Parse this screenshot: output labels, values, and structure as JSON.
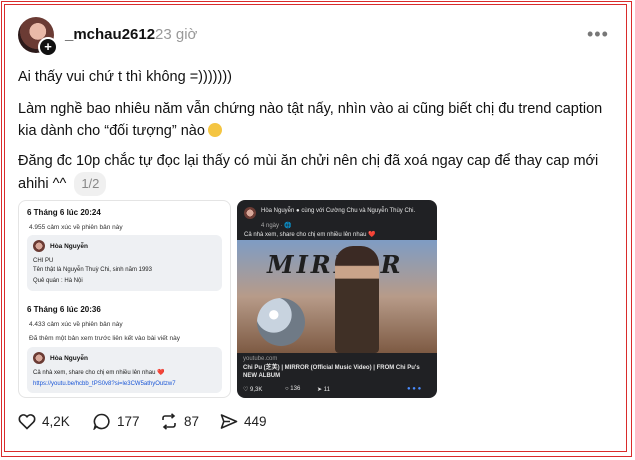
{
  "post": {
    "username": "_mchau2612",
    "time": "23 giờ",
    "more_label": "•••",
    "paragraph1": "Ai thấy vui chứ t thì không =)))))))",
    "paragraph2": "Làm nghề bao nhiêu năm vẫn chứng nào tật nấy, nhìn vào ai cũng biết chị đu trend caption kia dành cho “đối tượng” nào",
    "paragraph3": "Đăng đc 10p chắc tự đọc lại thấy có mùi ăn chửi nên chị đã xoá ngay cap để thay cap mới ahihi ^^",
    "pager": "1/2"
  },
  "image1": {
    "date1": "6 Tháng 6 lúc 20:24",
    "views1": "4.955 cảm xúc về phiên bản này",
    "name1": "Hòa Nguyễn",
    "line1": "CHI PU",
    "line2": "Tên thật là Nguyễn Thuỳ Chi, sinh năm 1993",
    "line3": "Quê quán : Hà Nội",
    "date2": "6 Tháng 6 lúc 20:36",
    "views2": "4.433 cảm xúc về phiên bản này",
    "added": "Đã thêm một bản xem trước liên kết vào bài viết này",
    "name2": "Hòa Nguyễn",
    "line4": "Cả nhà xem, share cho chị em nhiều lên nhau ❤️",
    "link": "https://youtu.be/hcbb_tPS0v8?si=le3CW5athyOutzw7"
  },
  "image2": {
    "header": "Hòa Nguyễn ● cùng với Cường Chu và Nguyễn Thùy Chi.",
    "date": "4 ngày · 🌐",
    "caption": "Cả nhà xem, share cho chị em nhiều lên nhau ❤️",
    "poster_title": "MIRROR",
    "source": "youtube.com",
    "video_title": "Chi Pu (芝芙) | MIRROR (Official Music Video) | FROM Chi Pu's NEW ALBUM",
    "likes": "9,3K",
    "comments": "136",
    "shares": "11"
  },
  "actions": {
    "likes": "4,2K",
    "comments": "177",
    "reposts": "87",
    "shares": "449"
  },
  "colors": {
    "frame": "#d92b2b",
    "muted": "#999999",
    "link": "#1a56d6"
  }
}
